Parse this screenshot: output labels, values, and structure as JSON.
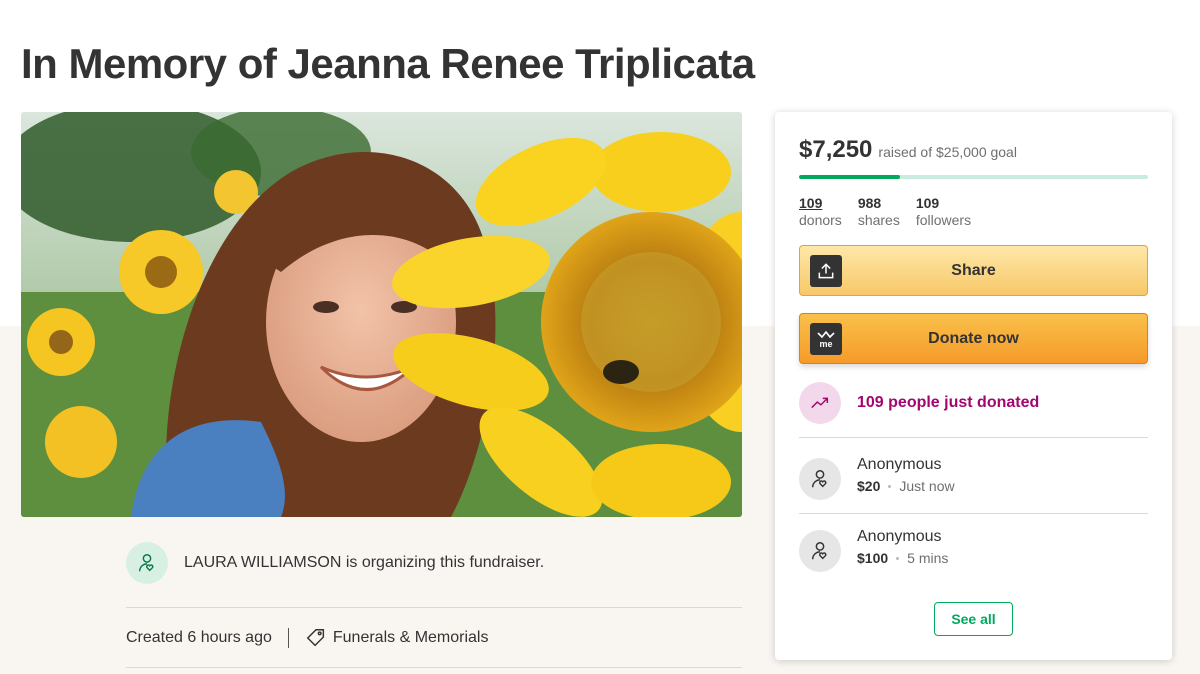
{
  "title": "In Memory of Jeanna Renee Triplicata",
  "hero": {
    "image": "woman-with-sunflower-photo"
  },
  "organizer": {
    "name": "LAURA WILLIAMSON",
    "text": " is organizing this fundraiser.",
    "icon": "user-heart-icon"
  },
  "meta": {
    "created": "Created 6 hours ago",
    "category": "Funerals & Memorials",
    "category_icon": "tag-icon"
  },
  "campaign": {
    "raised": "$7,250",
    "goal_text": "raised of $25,000 goal",
    "progress_fraction": 0.29,
    "stats": [
      {
        "num": "109",
        "label": "donors"
      },
      {
        "num": "988",
        "label": "shares"
      },
      {
        "num": "109",
        "label": "followers"
      }
    ],
    "share_label": "Share",
    "donate_label": "Donate now",
    "trend_text": "109 people just donated",
    "donations": [
      {
        "name": "Anonymous",
        "amount": "$20",
        "time": "Just now"
      },
      {
        "name": "Anonymous",
        "amount": "$100",
        "time": "5 mins"
      }
    ],
    "see_all_label": "See all"
  },
  "colors": {
    "brand_green": "#02a95c",
    "donate_orange": "#f59a2a",
    "trend_magenta": "#a2066f"
  }
}
